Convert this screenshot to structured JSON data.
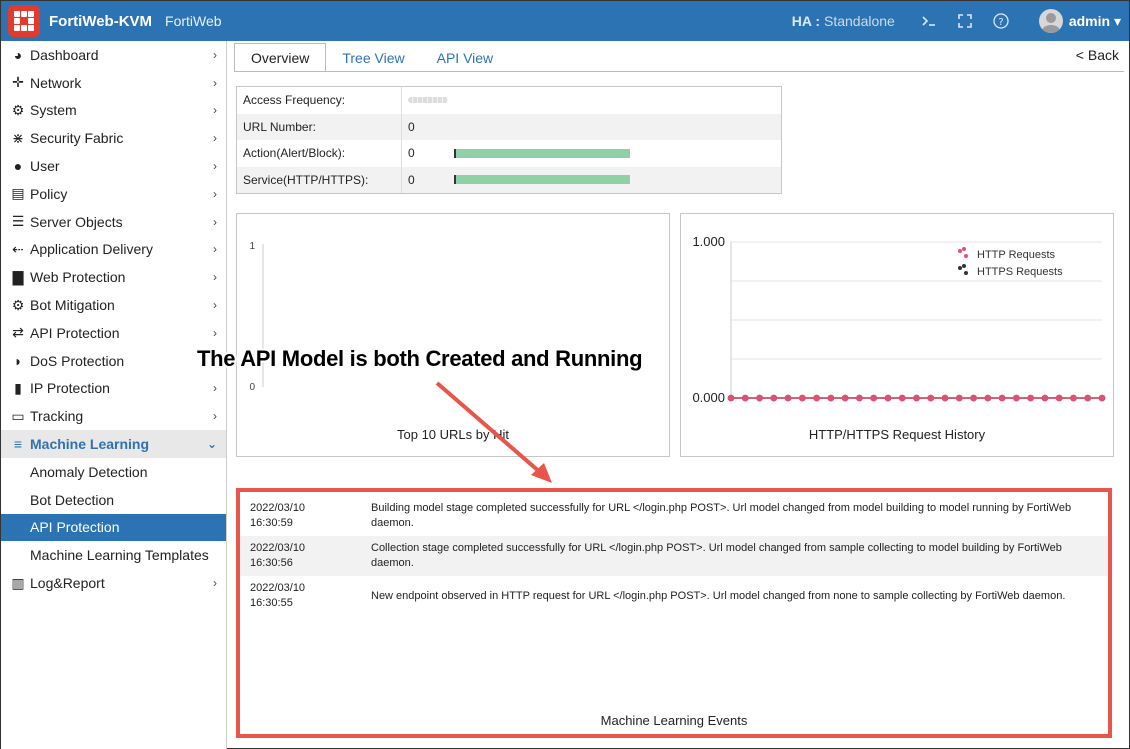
{
  "header": {
    "title": "FortiWeb-KVM",
    "subtitle": "FortiWeb",
    "ha_label": "HA :",
    "ha_value": "Standalone",
    "user": "admin"
  },
  "sidebar": {
    "items": [
      {
        "label": "Dashboard",
        "icon": "dashboard-icon"
      },
      {
        "label": "Network",
        "icon": "network-icon"
      },
      {
        "label": "System",
        "icon": "gear-icon"
      },
      {
        "label": "Security Fabric",
        "icon": "fabric-icon"
      },
      {
        "label": "User",
        "icon": "user-icon"
      },
      {
        "label": "Policy",
        "icon": "policy-icon"
      },
      {
        "label": "Server Objects",
        "icon": "server-icon"
      },
      {
        "label": "Application Delivery",
        "icon": "delivery-icon"
      },
      {
        "label": "Web Protection",
        "icon": "lock-icon"
      },
      {
        "label": "Bot Mitigation",
        "icon": "gears-icon"
      },
      {
        "label": "API Protection",
        "icon": "api-icon"
      },
      {
        "label": "DoS Protection",
        "icon": "shield-icon"
      },
      {
        "label": "IP Protection",
        "icon": "ip-icon"
      },
      {
        "label": "Tracking",
        "icon": "laptop-icon"
      },
      {
        "label": "Machine Learning",
        "icon": "menu-icon"
      }
    ],
    "sub_items": [
      {
        "label": "Anomaly Detection"
      },
      {
        "label": "Bot Detection"
      },
      {
        "label": "API Protection"
      },
      {
        "label": "Machine Learning Templates"
      }
    ],
    "last_item": {
      "label": "Log&Report",
      "icon": "chart-icon"
    }
  },
  "tabs": [
    "Overview",
    "Tree View",
    "API View"
  ],
  "back_label": "< Back",
  "stats": [
    {
      "label": "Access Frequency:",
      "value": ""
    },
    {
      "label": "URL Number:",
      "value": "0"
    },
    {
      "label": "Action(Alert/Block):",
      "value": "0"
    },
    {
      "label": "Service(HTTP/HTTPS):",
      "value": "0"
    }
  ],
  "chart_data": [
    {
      "type": "bar",
      "title": "Top 10 URLs by Hit",
      "categories": [],
      "values": [],
      "ylim": [
        0,
        1
      ],
      "yticks": [
        "1",
        "0"
      ]
    },
    {
      "type": "line",
      "title": "HTTP/HTTPS Request History",
      "ylim": [
        0,
        1
      ],
      "yticks": [
        "1.000",
        "0.000"
      ],
      "series": [
        {
          "name": "HTTP Requests",
          "color": "#e05070",
          "values": [
            0,
            0,
            0,
            0,
            0,
            0,
            0,
            0,
            0,
            0,
            0,
            0,
            0,
            0,
            0,
            0,
            0,
            0,
            0,
            0,
            0,
            0,
            0,
            0,
            0,
            0,
            0
          ]
        },
        {
          "name": "HTTPS Requests",
          "color": "#333333",
          "values": [
            0,
            0,
            0,
            0,
            0,
            0,
            0,
            0,
            0,
            0,
            0,
            0,
            0,
            0,
            0,
            0,
            0,
            0,
            0,
            0,
            0,
            0,
            0,
            0,
            0,
            0,
            0
          ]
        }
      ],
      "legend": "top-right"
    }
  ],
  "events": {
    "title": "Machine Learning Events",
    "rows": [
      {
        "time": "2022/03/10\n16:30:59",
        "msg": "Building model stage completed successfully for URL </login.php POST>. Url model changed from model building to model running by FortiWeb daemon."
      },
      {
        "time": "2022/03/10\n16:30:56",
        "msg": "Collection stage completed successfully for URL </login.php POST>. Url model changed from sample collecting to model building by FortiWeb daemon."
      },
      {
        "time": "2022/03/10\n16:30:55",
        "msg": "New endpoint observed in HTTP request for URL </login.php POST>. Url model changed from none to sample collecting by FortiWeb daemon."
      }
    ]
  },
  "callout": "The API Model is both Created and Running",
  "accent_color": "#2c73b4",
  "highlight_color": "#e8554a"
}
